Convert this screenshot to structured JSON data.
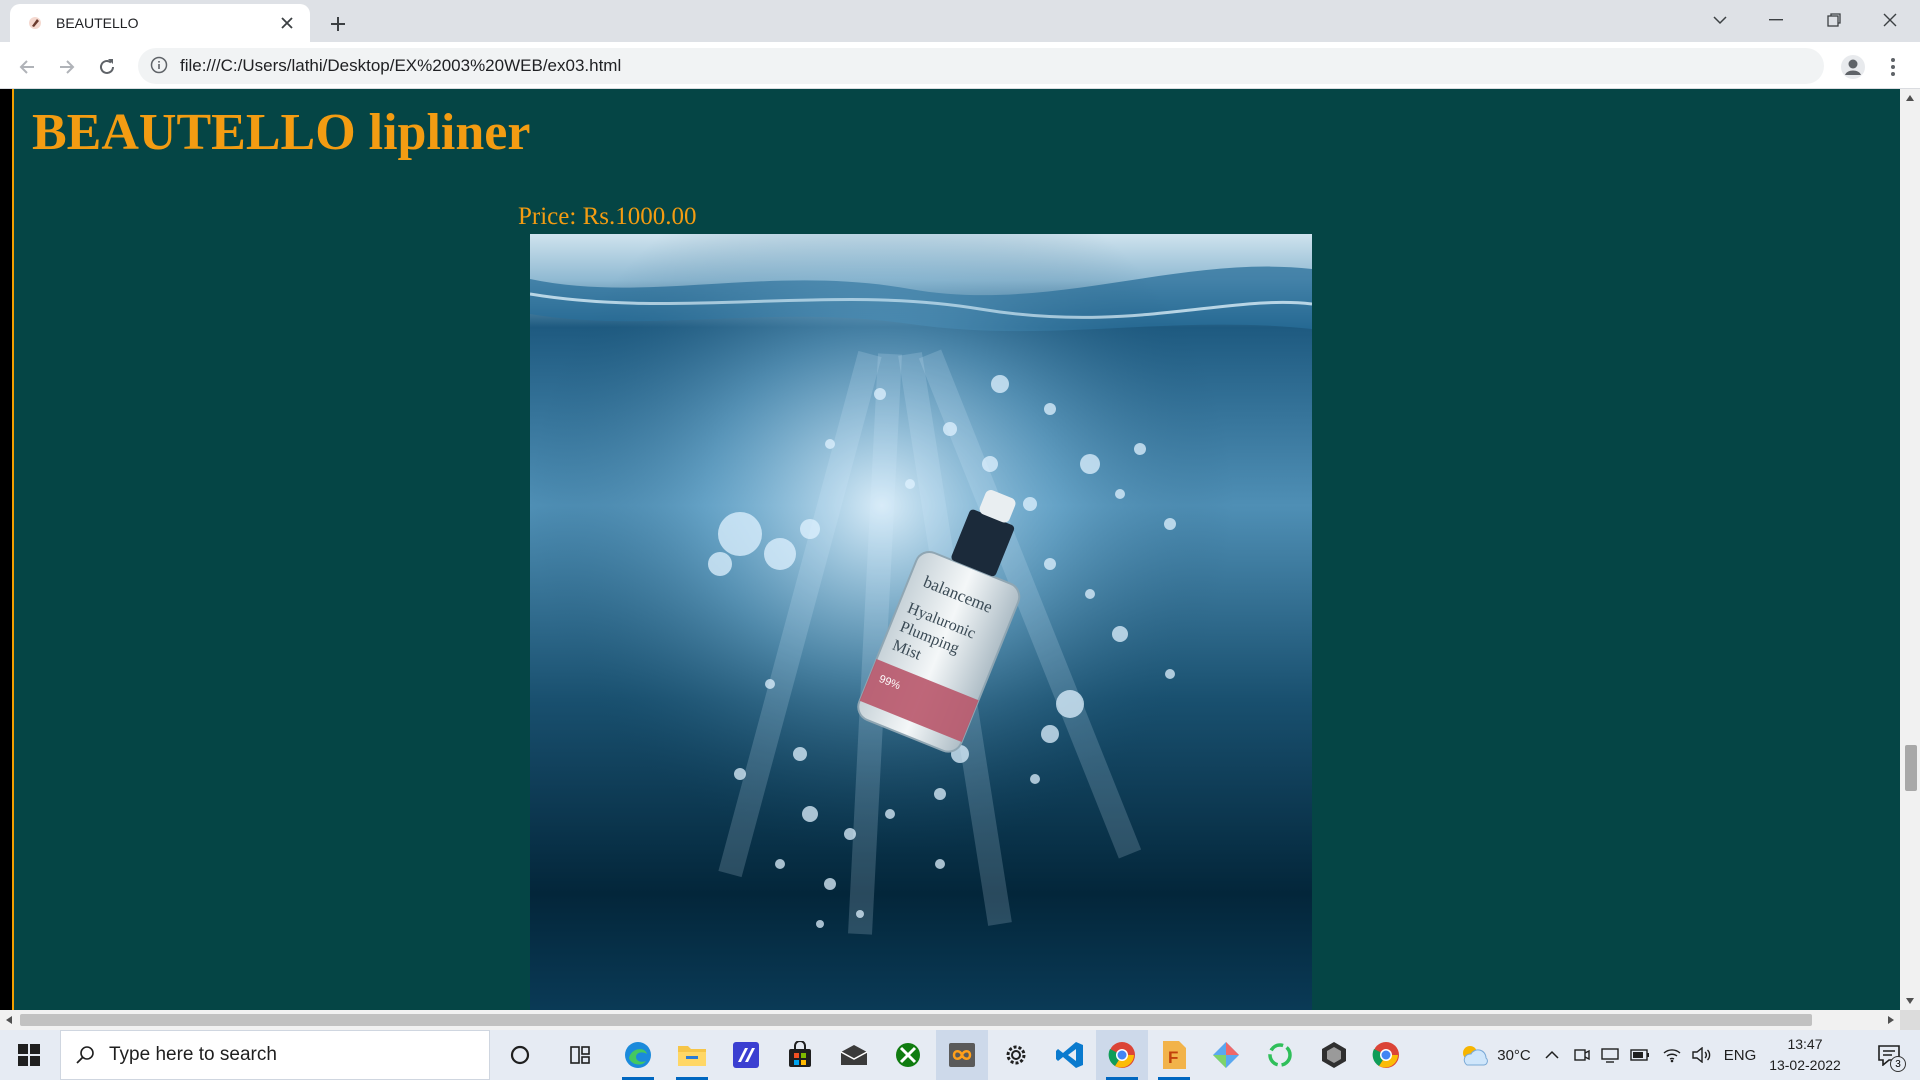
{
  "browser": {
    "tab": {
      "title": "BEAUTELLO",
      "favicon": "product-favicon-icon"
    },
    "new_tab_icon": "plus-icon",
    "window_controls": [
      "chevron-down-icon",
      "minimize-icon",
      "restore-icon",
      "close-icon"
    ],
    "address": {
      "url": "file:///C:/Users/lathi/Desktop/EX%2003%20WEB/ex03.html",
      "info_icon": "info-icon"
    }
  },
  "page": {
    "heading": "BEAUTELLO lipliner",
    "price": "Price: Rs.1000.00",
    "image": {
      "product_text_1": "balanceme",
      "product_text_2": "Hyaluronic",
      "product_text_3": "Plumping",
      "product_text_4": "Mist",
      "product_text_5": "99%"
    },
    "colors": {
      "background": "#054545",
      "accent": "#f39c12"
    }
  },
  "taskbar": {
    "search_placeholder": "Type here to search",
    "weather": "30°C",
    "language": "ENG",
    "time": "13:47",
    "date": "13-02-2022",
    "notifications": "3",
    "apps": [
      "cortana-icon",
      "task-view-icon",
      "edge-icon",
      "file-explorer-icon",
      "visual-studio-icon",
      "store-icon",
      "mail-icon",
      "xbox-icon",
      "app-icon",
      "settings-icon",
      "vscode-icon",
      "chrome-icon",
      "f-app-icon",
      "git-icon",
      "ring-app-icon",
      "unity-icon",
      "chrome-icon-2"
    ]
  }
}
